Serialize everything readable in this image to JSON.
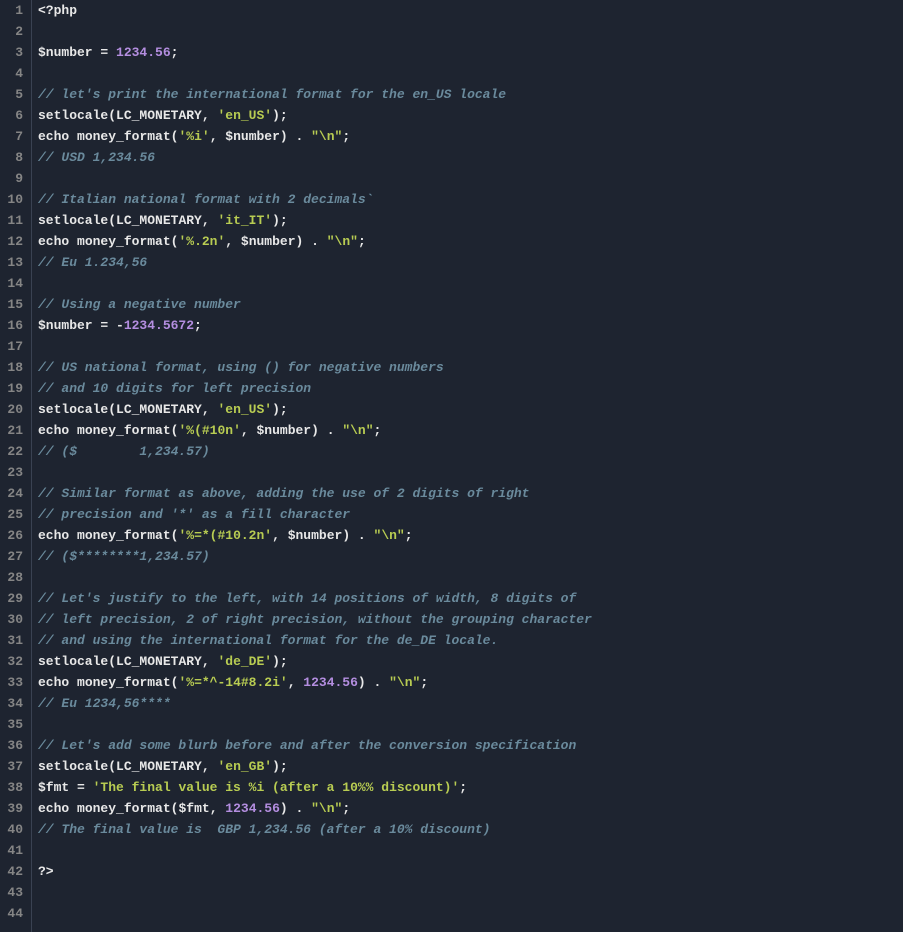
{
  "chart_data": null,
  "editor": {
    "lineCount": 44,
    "lines": [
      [
        {
          "t": "<?php",
          "c": "phptag"
        }
      ],
      [],
      [
        {
          "t": "$number",
          "c": "var"
        },
        {
          "t": " = ",
          "c": "operator"
        },
        {
          "t": "1234.56",
          "c": "number"
        },
        {
          "t": ";",
          "c": "punct"
        }
      ],
      [],
      [
        {
          "t": "// let's print the international format for the en_US locale",
          "c": "comment"
        }
      ],
      [
        {
          "t": "setlocale",
          "c": "func"
        },
        {
          "t": "(",
          "c": "punct"
        },
        {
          "t": "LC_MONETARY",
          "c": "const"
        },
        {
          "t": ", ",
          "c": "punct"
        },
        {
          "t": "'en_US'",
          "c": "string"
        },
        {
          "t": ");",
          "c": "punct"
        }
      ],
      [
        {
          "t": "echo",
          "c": "keyword"
        },
        {
          "t": " ",
          "c": "default"
        },
        {
          "t": "money_format",
          "c": "func"
        },
        {
          "t": "(",
          "c": "punct"
        },
        {
          "t": "'%i'",
          "c": "string"
        },
        {
          "t": ", ",
          "c": "punct"
        },
        {
          "t": "$number",
          "c": "var"
        },
        {
          "t": ") . ",
          "c": "punct"
        },
        {
          "t": "\"\\n\"",
          "c": "string"
        },
        {
          "t": ";",
          "c": "punct"
        }
      ],
      [
        {
          "t": "// USD 1,234.56",
          "c": "comment"
        }
      ],
      [],
      [
        {
          "t": "// Italian national format with 2 decimals`",
          "c": "comment"
        }
      ],
      [
        {
          "t": "setlocale",
          "c": "func"
        },
        {
          "t": "(",
          "c": "punct"
        },
        {
          "t": "LC_MONETARY",
          "c": "const"
        },
        {
          "t": ", ",
          "c": "punct"
        },
        {
          "t": "'it_IT'",
          "c": "string"
        },
        {
          "t": ");",
          "c": "punct"
        }
      ],
      [
        {
          "t": "echo",
          "c": "keyword"
        },
        {
          "t": " ",
          "c": "default"
        },
        {
          "t": "money_format",
          "c": "func"
        },
        {
          "t": "(",
          "c": "punct"
        },
        {
          "t": "'%.2n'",
          "c": "string"
        },
        {
          "t": ", ",
          "c": "punct"
        },
        {
          "t": "$number",
          "c": "var"
        },
        {
          "t": ") . ",
          "c": "punct"
        },
        {
          "t": "\"\\n\"",
          "c": "string"
        },
        {
          "t": ";",
          "c": "punct"
        }
      ],
      [
        {
          "t": "// Eu 1.234,56",
          "c": "comment"
        }
      ],
      [],
      [
        {
          "t": "// Using a negative number",
          "c": "comment"
        }
      ],
      [
        {
          "t": "$number",
          "c": "var"
        },
        {
          "t": " = -",
          "c": "operator"
        },
        {
          "t": "1234.5672",
          "c": "number"
        },
        {
          "t": ";",
          "c": "punct"
        }
      ],
      [],
      [
        {
          "t": "// US national format, using () for negative numbers",
          "c": "comment"
        }
      ],
      [
        {
          "t": "// and 10 digits for left precision",
          "c": "comment"
        }
      ],
      [
        {
          "t": "setlocale",
          "c": "func"
        },
        {
          "t": "(",
          "c": "punct"
        },
        {
          "t": "LC_MONETARY",
          "c": "const"
        },
        {
          "t": ", ",
          "c": "punct"
        },
        {
          "t": "'en_US'",
          "c": "string"
        },
        {
          "t": ");",
          "c": "punct"
        }
      ],
      [
        {
          "t": "echo",
          "c": "keyword"
        },
        {
          "t": " ",
          "c": "default"
        },
        {
          "t": "money_format",
          "c": "func"
        },
        {
          "t": "(",
          "c": "punct"
        },
        {
          "t": "'%(#10n'",
          "c": "string"
        },
        {
          "t": ", ",
          "c": "punct"
        },
        {
          "t": "$number",
          "c": "var"
        },
        {
          "t": ") . ",
          "c": "punct"
        },
        {
          "t": "\"\\n\"",
          "c": "string"
        },
        {
          "t": ";",
          "c": "punct"
        }
      ],
      [
        {
          "t": "// ($        1,234.57)",
          "c": "comment"
        }
      ],
      [],
      [
        {
          "t": "// Similar format as above, adding the use of 2 digits of right",
          "c": "comment"
        }
      ],
      [
        {
          "t": "// precision and '*' as a fill character",
          "c": "comment"
        }
      ],
      [
        {
          "t": "echo",
          "c": "keyword"
        },
        {
          "t": " ",
          "c": "default"
        },
        {
          "t": "money_format",
          "c": "func"
        },
        {
          "t": "(",
          "c": "punct"
        },
        {
          "t": "'%=*(#10.2n'",
          "c": "string"
        },
        {
          "t": ", ",
          "c": "punct"
        },
        {
          "t": "$number",
          "c": "var"
        },
        {
          "t": ") . ",
          "c": "punct"
        },
        {
          "t": "\"\\n\"",
          "c": "string"
        },
        {
          "t": ";",
          "c": "punct"
        }
      ],
      [
        {
          "t": "// ($********1,234.57)",
          "c": "comment"
        }
      ],
      [],
      [
        {
          "t": "// Let's justify to the left, with 14 positions of width, 8 digits of",
          "c": "comment"
        }
      ],
      [
        {
          "t": "// left precision, 2 of right precision, without the grouping character",
          "c": "comment"
        }
      ],
      [
        {
          "t": "// and using the international format for the de_DE locale.",
          "c": "comment"
        }
      ],
      [
        {
          "t": "setlocale",
          "c": "func"
        },
        {
          "t": "(",
          "c": "punct"
        },
        {
          "t": "LC_MONETARY",
          "c": "const"
        },
        {
          "t": ", ",
          "c": "punct"
        },
        {
          "t": "'de_DE'",
          "c": "string"
        },
        {
          "t": ");",
          "c": "punct"
        }
      ],
      [
        {
          "t": "echo",
          "c": "keyword"
        },
        {
          "t": " ",
          "c": "default"
        },
        {
          "t": "money_format",
          "c": "func"
        },
        {
          "t": "(",
          "c": "punct"
        },
        {
          "t": "'%=*^-14#8.2i'",
          "c": "string"
        },
        {
          "t": ", ",
          "c": "punct"
        },
        {
          "t": "1234.56",
          "c": "number"
        },
        {
          "t": ") . ",
          "c": "punct"
        },
        {
          "t": "\"\\n\"",
          "c": "string"
        },
        {
          "t": ";",
          "c": "punct"
        }
      ],
      [
        {
          "t": "// Eu 1234,56****",
          "c": "comment"
        }
      ],
      [],
      [
        {
          "t": "// Let's add some blurb before and after the conversion specification",
          "c": "comment"
        }
      ],
      [
        {
          "t": "setlocale",
          "c": "func"
        },
        {
          "t": "(",
          "c": "punct"
        },
        {
          "t": "LC_MONETARY",
          "c": "const"
        },
        {
          "t": ", ",
          "c": "punct"
        },
        {
          "t": "'en_GB'",
          "c": "string"
        },
        {
          "t": ");",
          "c": "punct"
        }
      ],
      [
        {
          "t": "$fmt",
          "c": "var"
        },
        {
          "t": " = ",
          "c": "operator"
        },
        {
          "t": "'The final value is %i (after a 10%% discount)'",
          "c": "string"
        },
        {
          "t": ";",
          "c": "punct"
        }
      ],
      [
        {
          "t": "echo",
          "c": "keyword"
        },
        {
          "t": " ",
          "c": "default"
        },
        {
          "t": "money_format",
          "c": "func"
        },
        {
          "t": "(",
          "c": "punct"
        },
        {
          "t": "$fmt",
          "c": "var"
        },
        {
          "t": ", ",
          "c": "punct"
        },
        {
          "t": "1234.56",
          "c": "number"
        },
        {
          "t": ") . ",
          "c": "punct"
        },
        {
          "t": "\"\\n\"",
          "c": "string"
        },
        {
          "t": ";",
          "c": "punct"
        }
      ],
      [
        {
          "t": "// The final value is  GBP 1,234.56 (after a 10% discount)",
          "c": "comment"
        }
      ],
      [],
      [
        {
          "t": "?>",
          "c": "phptag"
        }
      ],
      [],
      []
    ]
  }
}
